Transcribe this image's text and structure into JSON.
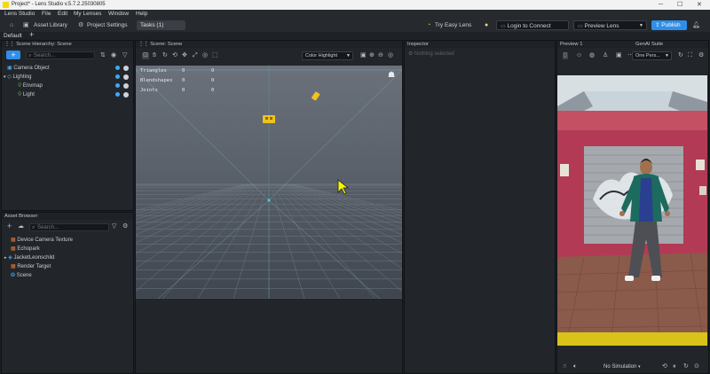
{
  "window": {
    "title": "Project* - Lens Studio v.5.7.2.25030805"
  },
  "menu": [
    "Lens Studio",
    "File",
    "Edit",
    "My Lenses",
    "Window",
    "Help"
  ],
  "toolbar": {
    "asset_library": "Asset Library",
    "project_settings": "Project Settings",
    "tasks": "Tasks (1)",
    "try_easy_lens": "Try Easy Lens",
    "login": "Login to Connect",
    "preview_lens": "Preview Lens",
    "publish": "Publish"
  },
  "layout_tab": "Default",
  "scene_hierarchy": {
    "title": "Scene Hierarchy: Scene",
    "search_placeholder": "Search...",
    "items": [
      "Camera Object",
      "Lighting",
      "Envmap",
      "Light"
    ]
  },
  "scene": {
    "title": "Scene: Scene",
    "dropdown": "Color Highlight",
    "stats": [
      {
        "label": "Triangles",
        "v1": "0",
        "v2": "0"
      },
      {
        "label": "Blendshapes",
        "v1": "0",
        "v2": "0"
      },
      {
        "label": "Joints",
        "v1": "0",
        "v2": "0"
      }
    ]
  },
  "inspector": {
    "title": "Inspector",
    "empty": "Nothing selected"
  },
  "preview": {
    "title": "Preview 1",
    "genai_title": "GenAI Suite",
    "camera": "One Pers...",
    "simulation": "No Simulation"
  },
  "asset_browser": {
    "title": "Asset Browser",
    "search_placeholder": "Search...",
    "items": [
      "Device Camera Texture",
      "Echopark",
      "JacketLeonschild",
      "Render Target",
      "Scene"
    ]
  },
  "colors": {
    "accent": "#2f8fe8",
    "gizmo": "#f2c21b",
    "title": "#f2f2f2"
  }
}
